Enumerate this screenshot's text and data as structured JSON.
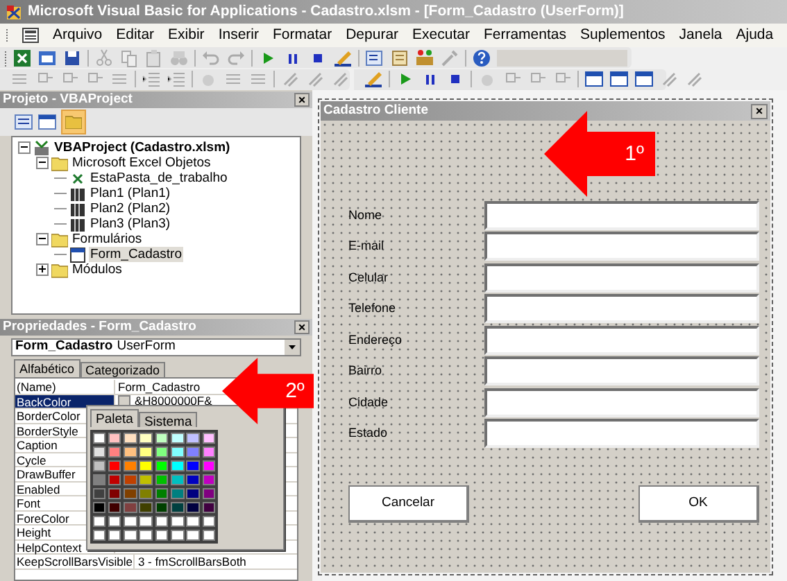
{
  "window": {
    "title": "Microsoft Visual Basic for Applications - Cadastro.xlsm - [Form_Cadastro (UserForm)]"
  },
  "menu": [
    "Arquivo",
    "Editar",
    "Exibir",
    "Inserir",
    "Formatar",
    "Depurar",
    "Executar",
    "Ferramentas",
    "Suplementos",
    "Janela",
    "Ajuda"
  ],
  "project": {
    "title": "Projeto - VBAProject",
    "close": "×",
    "tree": [
      {
        "label": "VBAProject (Cadastro.xlsm)",
        "kind": "project",
        "expanded": true,
        "selected": false,
        "children": [
          {
            "label": "Microsoft Excel Objetos",
            "kind": "folder",
            "expanded": true,
            "selected": false,
            "children": [
              {
                "label": "EstaPasta_de_trabalho",
                "kind": "workbook",
                "selected": false
              },
              {
                "label": "Plan1 (Plan1)",
                "kind": "sheet",
                "selected": false
              },
              {
                "label": "Plan2 (Plan2)",
                "kind": "sheet",
                "selected": false
              },
              {
                "label": "Plan3 (Plan3)",
                "kind": "sheet",
                "selected": false
              }
            ]
          },
          {
            "label": "Formulários",
            "kind": "folder",
            "expanded": true,
            "selected": false,
            "children": [
              {
                "label": "Form_Cadastro",
                "kind": "form",
                "selected": true
              }
            ]
          },
          {
            "label": "Módulos",
            "kind": "folder",
            "expanded": false,
            "selected": false
          }
        ]
      }
    ]
  },
  "properties": {
    "title": "Propriedades - Form_Cadastro",
    "close": "×",
    "object": {
      "name": "Form_Cadastro",
      "type": "UserForm"
    },
    "tabs": [
      {
        "label": "Alfabético",
        "selected": true
      },
      {
        "label": "Categorizado",
        "selected": false
      }
    ],
    "rows": [
      {
        "name": "(Name)",
        "value": "Form_Cadastro",
        "selected": false
      },
      {
        "name": "BackColor",
        "value": "&H8000000F&",
        "selected": true
      },
      {
        "name": "BorderColor",
        "selected": false
      },
      {
        "name": "BorderStyle",
        "selected": false
      },
      {
        "name": "Caption",
        "selected": false
      },
      {
        "name": "Cycle",
        "selected": false
      },
      {
        "name": "DrawBuffer",
        "selected": false
      },
      {
        "name": "Enabled",
        "selected": false
      },
      {
        "name": "Font",
        "selected": false
      },
      {
        "name": "ForeColor",
        "selected": false
      },
      {
        "name": "Height",
        "selected": false
      },
      {
        "name": "HelpContext",
        "selected": false
      },
      {
        "name": "KeepScrollBarsVisible",
        "value": "3 - fmScrollBarsBoth",
        "selected": false
      }
    ],
    "palette": {
      "tabs": [
        {
          "label": "Paleta",
          "selected": true
        },
        {
          "label": "Sistema",
          "selected": false
        }
      ],
      "rows": [
        [
          {
            "color": "#ffffff"
          },
          {
            "color": "#ffc0c0"
          },
          {
            "color": "#ffe0c0"
          },
          {
            "color": "#ffffc0"
          },
          {
            "color": "#c0ffc0"
          },
          {
            "color": "#c0ffff"
          },
          {
            "color": "#c0c0ff"
          },
          {
            "color": "#ffc0ff"
          }
        ],
        [
          {
            "color": "#e0e0e0"
          },
          {
            "color": "#ff8080"
          },
          {
            "color": "#ffc080"
          },
          {
            "color": "#ffff80"
          },
          {
            "color": "#80ff80"
          },
          {
            "color": "#80ffff"
          },
          {
            "color": "#8080ff"
          },
          {
            "color": "#ff80ff"
          }
        ],
        [
          {
            "color": "#c0c0c0"
          },
          {
            "color": "#ff0000"
          },
          {
            "color": "#ff8000"
          },
          {
            "color": "#ffff00"
          },
          {
            "color": "#00ff00"
          },
          {
            "color": "#00ffff"
          },
          {
            "color": "#0000ff"
          },
          {
            "color": "#ff00ff"
          }
        ],
        [
          {
            "color": "#808080"
          },
          {
            "color": "#c00000"
          },
          {
            "color": "#c04000"
          },
          {
            "color": "#c0c000"
          },
          {
            "color": "#00c000"
          },
          {
            "color": "#00c0c0"
          },
          {
            "color": "#0000c0"
          },
          {
            "color": "#c000c0"
          }
        ],
        [
          {
            "color": "#404040"
          },
          {
            "color": "#800000"
          },
          {
            "color": "#804000"
          },
          {
            "color": "#808000"
          },
          {
            "color": "#008000"
          },
          {
            "color": "#008080"
          },
          {
            "color": "#000080"
          },
          {
            "color": "#800080"
          }
        ],
        [
          {
            "color": "#000000"
          },
          {
            "color": "#400000"
          },
          {
            "color": "#804040"
          },
          {
            "color": "#404000"
          },
          {
            "color": "#004000"
          },
          {
            "color": "#004040"
          },
          {
            "color": "#000040"
          },
          {
            "color": "#400040"
          }
        ],
        [
          {
            "color": "#ffffff"
          },
          {
            "color": "#ffffff"
          },
          {
            "color": "#ffffff"
          },
          {
            "color": "#ffffff"
          },
          {
            "color": "#ffffff"
          },
          {
            "color": "#ffffff"
          },
          {
            "color": "#ffffff"
          },
          {
            "color": "#ffffff"
          }
        ],
        [
          {
            "color": "#ffffff"
          },
          {
            "color": "#ffffff"
          },
          {
            "color": "#ffffff"
          },
          {
            "color": "#ffffff"
          },
          {
            "color": "#ffffff"
          },
          {
            "color": "#ffffff"
          },
          {
            "color": "#ffffff"
          },
          {
            "color": "#ffffff"
          }
        ]
      ]
    }
  },
  "form": {
    "title": "Cadastro Cliente",
    "close": "×",
    "fields": [
      {
        "label": "Nome"
      },
      {
        "label": "E-mail"
      },
      {
        "label": "Celular"
      },
      {
        "label": "Telefone"
      },
      {
        "label": "Endereço"
      },
      {
        "label": "Bairro"
      },
      {
        "label": "Cidade"
      },
      {
        "label": "Estado"
      }
    ],
    "buttons": [
      "Cancelar",
      "OK"
    ]
  },
  "annotations": [
    {
      "label": "1º"
    },
    {
      "label": "2º"
    }
  ]
}
